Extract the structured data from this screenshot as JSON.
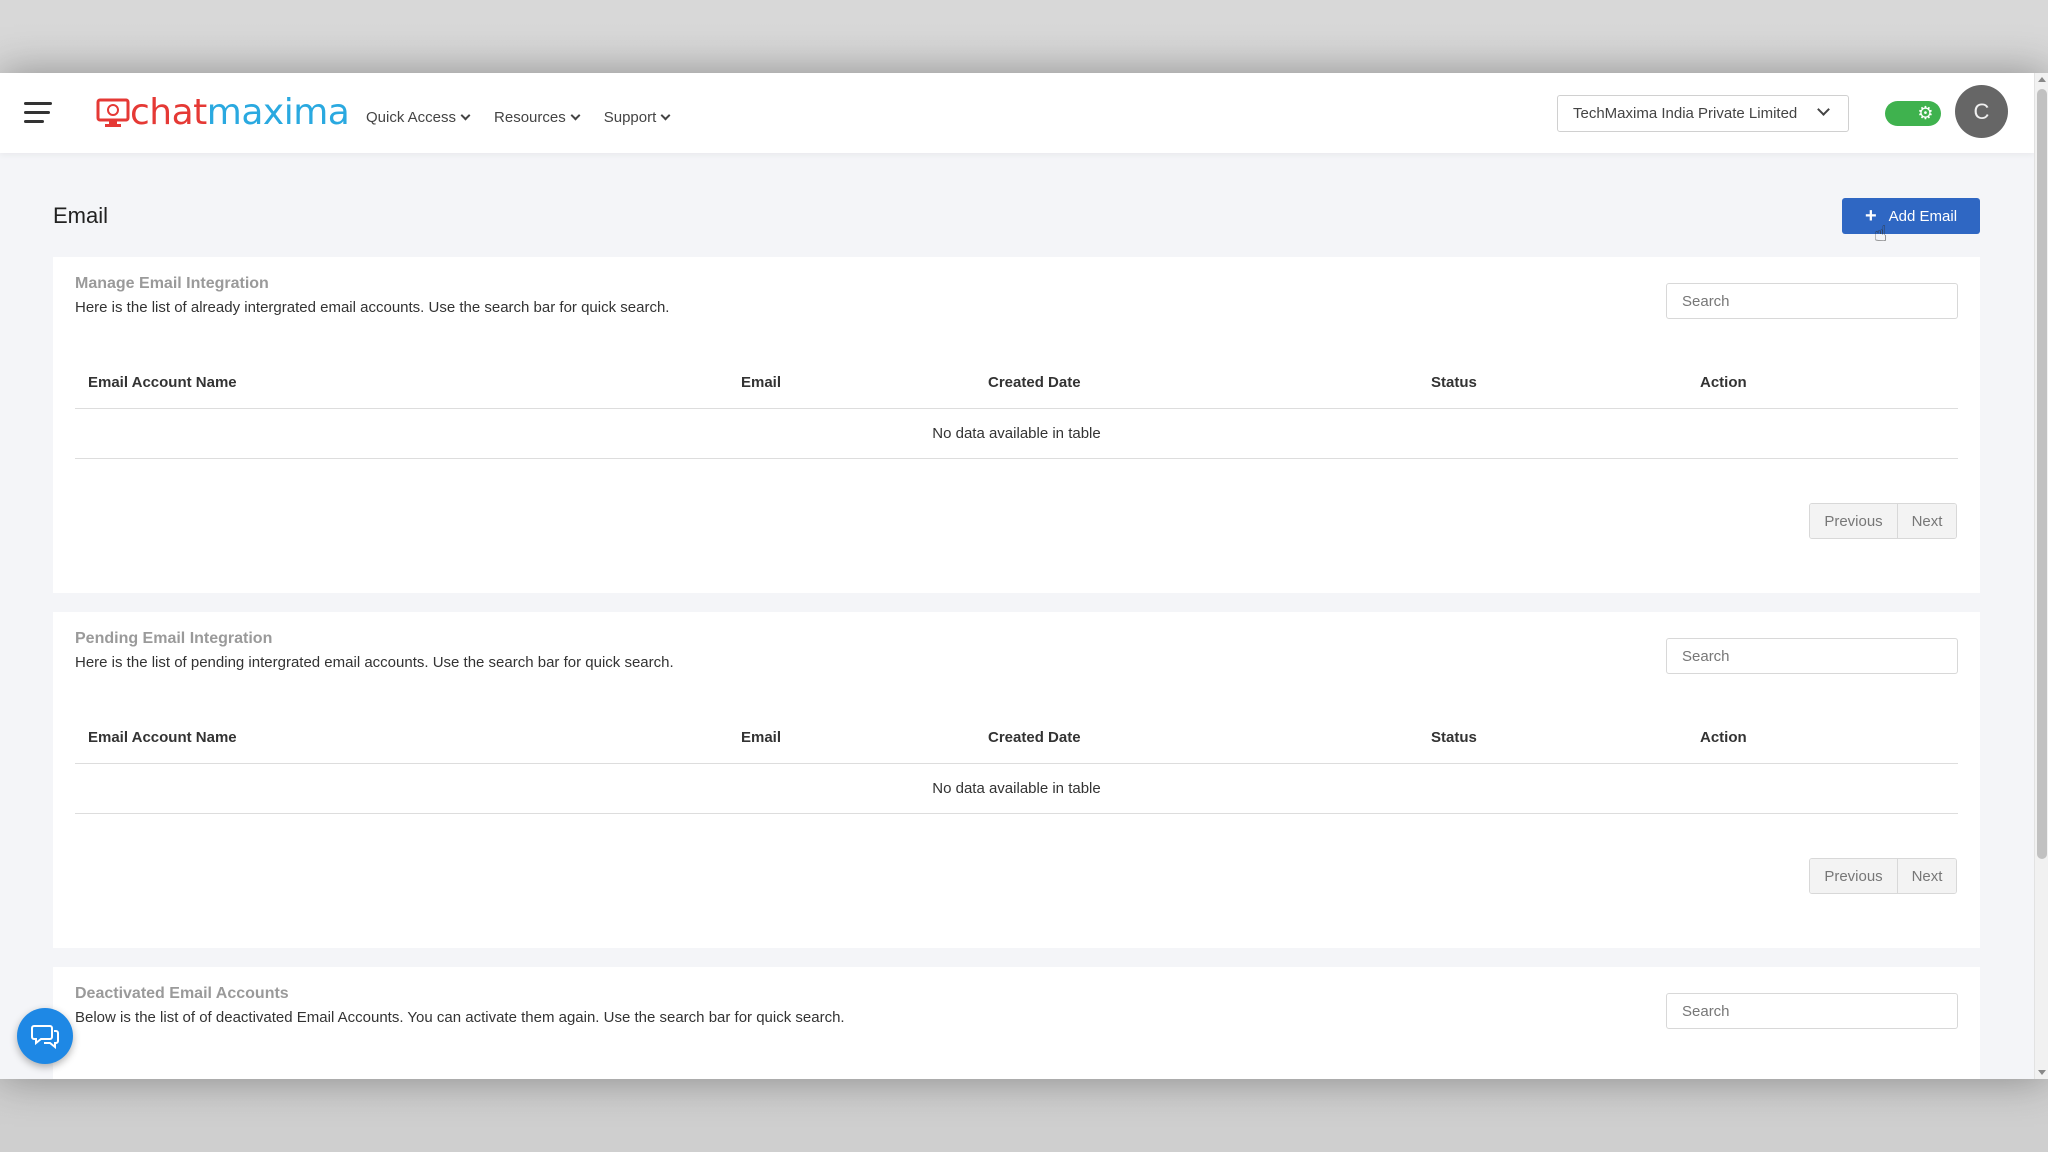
{
  "header": {
    "logo": {
      "part1": "chat",
      "part2": "maxima"
    },
    "nav": [
      {
        "label": "Quick Access"
      },
      {
        "label": "Resources"
      },
      {
        "label": "Support"
      }
    ],
    "org_select": "TechMaxima India Private Limited",
    "avatar_initial": "C"
  },
  "page": {
    "title": "Email",
    "add_button_label": "Add Email"
  },
  "columns": [
    "Email Account Name",
    "Email",
    "Created Date",
    "Status",
    "Action"
  ],
  "sections": [
    {
      "title": "Manage Email Integration",
      "description": "Here is the list of already intergrated email accounts. Use the search bar for quick search.",
      "search_placeholder": "Search",
      "empty_text": "No data available in table",
      "prev_label": "Previous",
      "next_label": "Next"
    },
    {
      "title": "Pending Email Integration",
      "description": "Here is the list of pending intergrated email accounts. Use the search bar for quick search.",
      "search_placeholder": "Search",
      "empty_text": "No data available in table",
      "prev_label": "Previous",
      "next_label": "Next"
    },
    {
      "title": "Deactivated Email Accounts",
      "description": "Below is the list of of deactivated Email Accounts. You can activate them again. Use the search bar for quick search.",
      "search_placeholder": "Search"
    }
  ],
  "colors": {
    "accent": "#2f67c3",
    "toggle": "#3fb24e",
    "chat_fab": "#1e88e5"
  }
}
